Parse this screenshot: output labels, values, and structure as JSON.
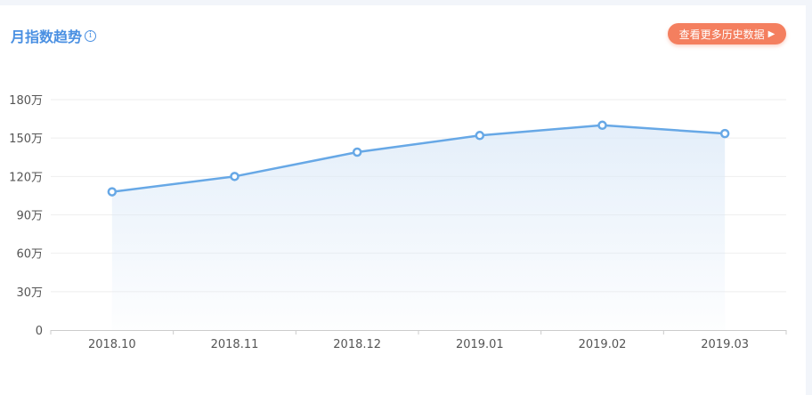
{
  "header": {
    "title": "月指数趋势",
    "info_glyph": "i",
    "history_button_label": "查看更多历史数据",
    "history_button_arrow": "▶"
  },
  "colors": {
    "accent": "#4a90e2",
    "line": "#67a8e6",
    "button": "#f47f5f",
    "grid": "#eeeeee"
  },
  "chart_data": {
    "type": "area",
    "categories": [
      "2018.10",
      "2018.11",
      "2018.12",
      "2019.01",
      "2019.02",
      "2019.03"
    ],
    "values": [
      108,
      120,
      139,
      152,
      160,
      153.5
    ],
    "y_ticks": [
      0,
      30,
      60,
      90,
      120,
      150,
      180
    ],
    "y_tick_labels": [
      "0",
      "30万",
      "60万",
      "90万",
      "120万",
      "150万",
      "180万"
    ],
    "ylim": [
      0,
      180
    ],
    "grid": true
  }
}
